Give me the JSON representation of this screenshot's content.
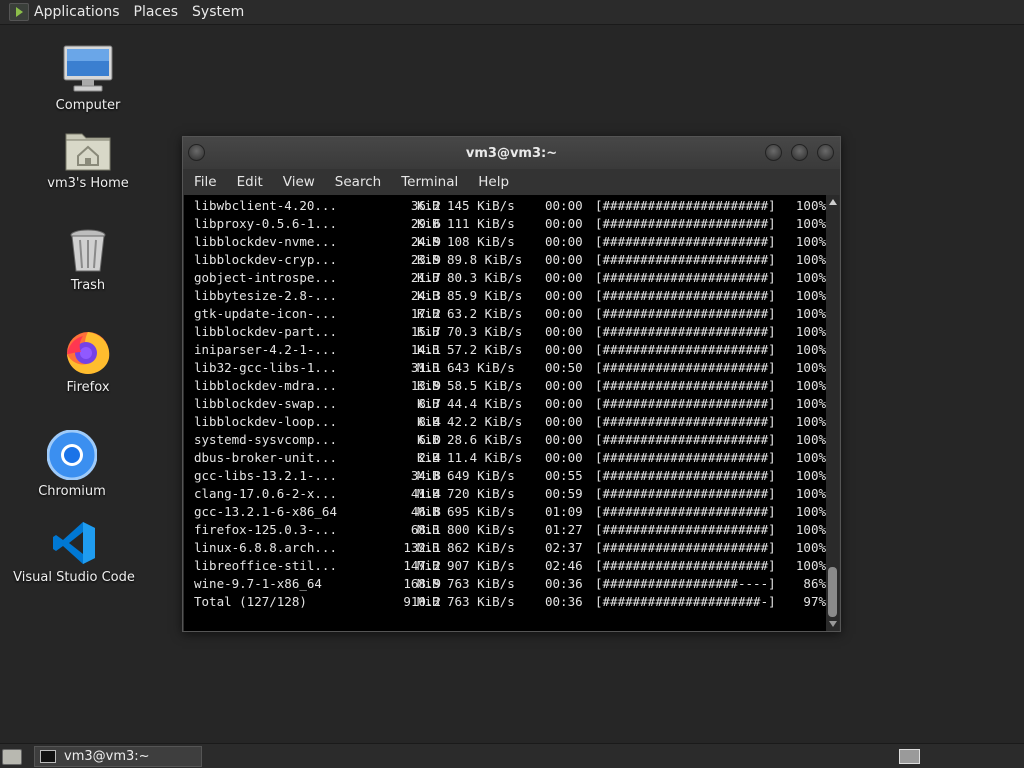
{
  "top_panel": {
    "menus": [
      "Applications",
      "Places",
      "System"
    ]
  },
  "desktop": {
    "icons": [
      {
        "label": "Computer",
        "icon": "computer-icon"
      },
      {
        "label": "vm3's Home",
        "icon": "home-folder-icon"
      },
      {
        "label": "Trash",
        "icon": "trash-icon"
      },
      {
        "label": "Firefox",
        "icon": "firefox-icon"
      },
      {
        "label": "Chromium",
        "icon": "chromium-icon"
      },
      {
        "label": "Visual Studio Code",
        "icon": "vscode-icon"
      }
    ]
  },
  "terminal": {
    "title": "vm3@vm3:~",
    "menu": [
      "File",
      "Edit",
      "View",
      "Search",
      "Terminal",
      "Help"
    ],
    "rows": [
      {
        "name": "libwbclient-4.20...",
        "size": "36.2",
        "unit": "KiB",
        "rate": "145 KiB/s",
        "time": "00:00",
        "bar": "[######################]",
        "pct": "100%"
      },
      {
        "name": "libproxy-0.5.6-1...",
        "size": "29.6",
        "unit": "KiB",
        "rate": "111 KiB/s",
        "time": "00:00",
        "bar": "[######################]",
        "pct": "100%"
      },
      {
        "name": "libblockdev-nvme...",
        "size": "24.9",
        "unit": "KiB",
        "rate": "108 KiB/s",
        "time": "00:00",
        "bar": "[######################]",
        "pct": "100%"
      },
      {
        "name": "libblockdev-cryp...",
        "size": "23.9",
        "unit": "KiB",
        "rate": "89.8 KiB/s",
        "time": "00:00",
        "bar": "[######################]",
        "pct": "100%"
      },
      {
        "name": "gobject-introspe...",
        "size": "21.7",
        "unit": "KiB",
        "rate": "80.3 KiB/s",
        "time": "00:00",
        "bar": "[######################]",
        "pct": "100%"
      },
      {
        "name": "libbytesize-2.8-...",
        "size": "24.3",
        "unit": "KiB",
        "rate": "85.9 KiB/s",
        "time": "00:00",
        "bar": "[######################]",
        "pct": "100%"
      },
      {
        "name": "gtk-update-icon-...",
        "size": "17.2",
        "unit": "KiB",
        "rate": "63.2 KiB/s",
        "time": "00:00",
        "bar": "[######################]",
        "pct": "100%"
      },
      {
        "name": "libblockdev-part...",
        "size": "15.7",
        "unit": "KiB",
        "rate": "70.3 KiB/s",
        "time": "00:00",
        "bar": "[######################]",
        "pct": "100%"
      },
      {
        "name": "iniparser-4.2-1-...",
        "size": "14.1",
        "unit": "KiB",
        "rate": "57.2 KiB/s",
        "time": "00:00",
        "bar": "[######################]",
        "pct": "100%"
      },
      {
        "name": "lib32-gcc-libs-1...",
        "size": "31.1",
        "unit": "MiB",
        "rate": "643 KiB/s",
        "time": "00:50",
        "bar": "[######################]",
        "pct": "100%"
      },
      {
        "name": "libblockdev-mdra...",
        "size": "13.9",
        "unit": "KiB",
        "rate": "58.5 KiB/s",
        "time": "00:00",
        "bar": "[######################]",
        "pct": "100%"
      },
      {
        "name": "libblockdev-swap...",
        "size": "8.7",
        "unit": "KiB",
        "rate": "44.4 KiB/s",
        "time": "00:00",
        "bar": "[######################]",
        "pct": "100%"
      },
      {
        "name": "libblockdev-loop...",
        "size": "8.4",
        "unit": "KiB",
        "rate": "42.2 KiB/s",
        "time": "00:00",
        "bar": "[######################]",
        "pct": "100%"
      },
      {
        "name": "systemd-sysvcomp...",
        "size": "6.0",
        "unit": "KiB",
        "rate": "28.6 KiB/s",
        "time": "00:00",
        "bar": "[######################]",
        "pct": "100%"
      },
      {
        "name": "dbus-broker-unit...",
        "size": "2.4",
        "unit": "KiB",
        "rate": "11.4 KiB/s",
        "time": "00:00",
        "bar": "[######################]",
        "pct": "100%"
      },
      {
        "name": "gcc-libs-13.2.1-...",
        "size": "34.8",
        "unit": "MiB",
        "rate": "649 KiB/s",
        "time": "00:55",
        "bar": "[######################]",
        "pct": "100%"
      },
      {
        "name": "clang-17.0.6-2-x...",
        "size": "41.4",
        "unit": "MiB",
        "rate": "720 KiB/s",
        "time": "00:59",
        "bar": "[######################]",
        "pct": "100%"
      },
      {
        "name": "gcc-13.2.1-6-x86_64",
        "size": "46.8",
        "unit": "MiB",
        "rate": "695 KiB/s",
        "time": "01:09",
        "bar": "[######################]",
        "pct": "100%"
      },
      {
        "name": "firefox-125.0.3-...",
        "size": "68.1",
        "unit": "MiB",
        "rate": "800 KiB/s",
        "time": "01:27",
        "bar": "[######################]",
        "pct": "100%"
      },
      {
        "name": "linux-6.8.8.arch...",
        "size": "132.1",
        "unit": "MiB",
        "rate": "862 KiB/s",
        "time": "02:37",
        "bar": "[######################]",
        "pct": "100%"
      },
      {
        "name": "libreoffice-stil...",
        "size": "147.2",
        "unit": "MiB",
        "rate": "907 KiB/s",
        "time": "02:46",
        "bar": "[######################]",
        "pct": "100%"
      },
      {
        "name": "wine-9.7-1-x86_64",
        "size": "168.9",
        "unit": "MiB",
        "rate": "763 KiB/s",
        "time": "00:36",
        "bar": "[##################----]",
        "pct": "86%"
      },
      {
        "name": "Total (127/128)",
        "size": "910.2",
        "unit": "MiB",
        "rate": "763 KiB/s",
        "time": "00:36",
        "bar": "[#####################-]",
        "pct": "97%"
      }
    ]
  },
  "taskbar": {
    "window_label": "vm3@vm3:~"
  }
}
